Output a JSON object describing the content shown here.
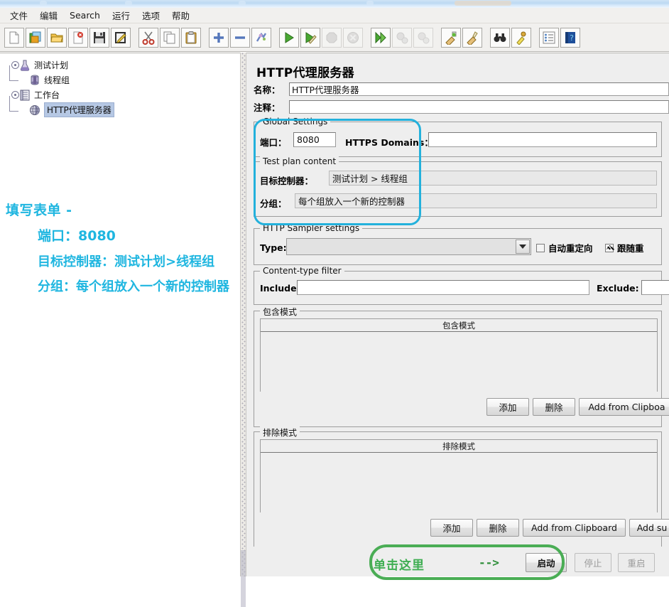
{
  "menu": {
    "items": [
      {
        "label": "文件",
        "name": "menu-file"
      },
      {
        "label": "编辑",
        "name": "menu-edit"
      },
      {
        "label": "Search",
        "name": "menu-search"
      },
      {
        "label": "运行",
        "name": "menu-run"
      },
      {
        "label": "选项",
        "name": "menu-options"
      },
      {
        "label": "帮助",
        "name": "menu-help"
      }
    ]
  },
  "toolbar": {
    "buttons": [
      {
        "icon": "new-document-icon",
        "enabled": true
      },
      {
        "icon": "templates-icon",
        "enabled": true
      },
      {
        "icon": "open-folder-icon",
        "enabled": true
      },
      {
        "icon": "close-document-icon",
        "enabled": true
      },
      {
        "icon": "save-icon",
        "enabled": true
      },
      {
        "icon": "save-as-icon",
        "enabled": true
      },
      {
        "icon": "cut-icon",
        "enabled": true
      },
      {
        "icon": "copy-icon",
        "enabled": true
      },
      {
        "icon": "paste-icon",
        "enabled": true
      },
      {
        "icon": "expand-plus-icon",
        "enabled": true
      },
      {
        "icon": "collapse-minus-icon",
        "enabled": true
      },
      {
        "icon": "toggle-icon",
        "enabled": true
      },
      {
        "icon": "start-icon",
        "enabled": true
      },
      {
        "icon": "start-no-timers-icon",
        "enabled": true
      },
      {
        "icon": "stop-icon",
        "enabled": false
      },
      {
        "icon": "shutdown-icon",
        "enabled": false
      },
      {
        "icon": "start-remote-icon",
        "enabled": true
      },
      {
        "icon": "stop-remote-icon",
        "enabled": false
      },
      {
        "icon": "shutdown-remote-icon",
        "enabled": false
      },
      {
        "icon": "clear-icon",
        "enabled": true
      },
      {
        "icon": "clear-all-icon",
        "enabled": true
      },
      {
        "icon": "search-binoculars-icon",
        "enabled": true
      },
      {
        "icon": "reset-search-icon",
        "enabled": true
      },
      {
        "icon": "function-helper-icon",
        "enabled": true
      },
      {
        "icon": "help-book-icon",
        "enabled": true
      }
    ]
  },
  "tree": {
    "nodes": [
      {
        "label": "测试计划",
        "icon": "test-plan-icon",
        "depth": 0,
        "selected": false
      },
      {
        "label": "线程组",
        "icon": "thread-group-icon",
        "depth": 1,
        "selected": false
      },
      {
        "label": "工作台",
        "icon": "workbench-icon",
        "depth": 0,
        "selected": false
      },
      {
        "label": "HTTP代理服务器",
        "icon": "http-proxy-icon",
        "depth": 1,
        "selected": true
      }
    ]
  },
  "annotation": {
    "line1": "填写表单 -",
    "line2": "端口：8080",
    "line3": "目标控制器：测试计划>线程组",
    "line4": "分组：每个组放入一个新的控制器",
    "color": "#1fb6e0"
  },
  "panel": {
    "title": "HTTP代理服务器",
    "name_label": "名称：",
    "name_value": "HTTP代理服务器",
    "comment_label": "注释：",
    "comment_value": ""
  },
  "global_settings": {
    "title": "Global Settings",
    "port_label": "端口：",
    "port_value": "8080",
    "https_domains_label": "HTTPS Domains：",
    "https_domains_value": ""
  },
  "test_plan_content": {
    "title": "Test plan content",
    "target_controller_label": "目标控制器：",
    "target_controller_value": "测试计划 > 线程组",
    "grouping_label": "分组：",
    "grouping_value": "每个组放入一个新的控制器"
  },
  "sampler_settings": {
    "title": "HTTP Sampler settings",
    "type_label": "Type:",
    "type_value": "",
    "redirect_auto_label": "自动重定向",
    "redirect_auto_checked": false,
    "redirect_follow_label": "跟随重",
    "redirect_follow_checked": true
  },
  "content_type_filter": {
    "title": "Content-type filter",
    "include_label": "Include:",
    "include_value": "",
    "exclude_label": "Exclude:",
    "exclude_value": ""
  },
  "include_patterns": {
    "title": "包含模式",
    "column_header": "包含模式",
    "rows": [],
    "buttons": [
      "添加",
      "删除",
      "Add from Clipboa"
    ]
  },
  "exclude_patterns": {
    "title": "排除模式",
    "column_header": "排除模式",
    "rows": [],
    "buttons": [
      "添加",
      "删除",
      "Add from Clipboard",
      "Add su"
    ]
  },
  "bottom_controls": {
    "click_here_label": "单击这里",
    "arrow": "-->",
    "start_label": "启动",
    "stop_label": "停止",
    "restart_label": "重启",
    "start_enabled": true,
    "stop_enabled": false,
    "restart_enabled": false,
    "highlight_color": "#4aad55"
  },
  "highlights": {
    "cyan": "#23b1dc",
    "green": "#4aad55"
  }
}
